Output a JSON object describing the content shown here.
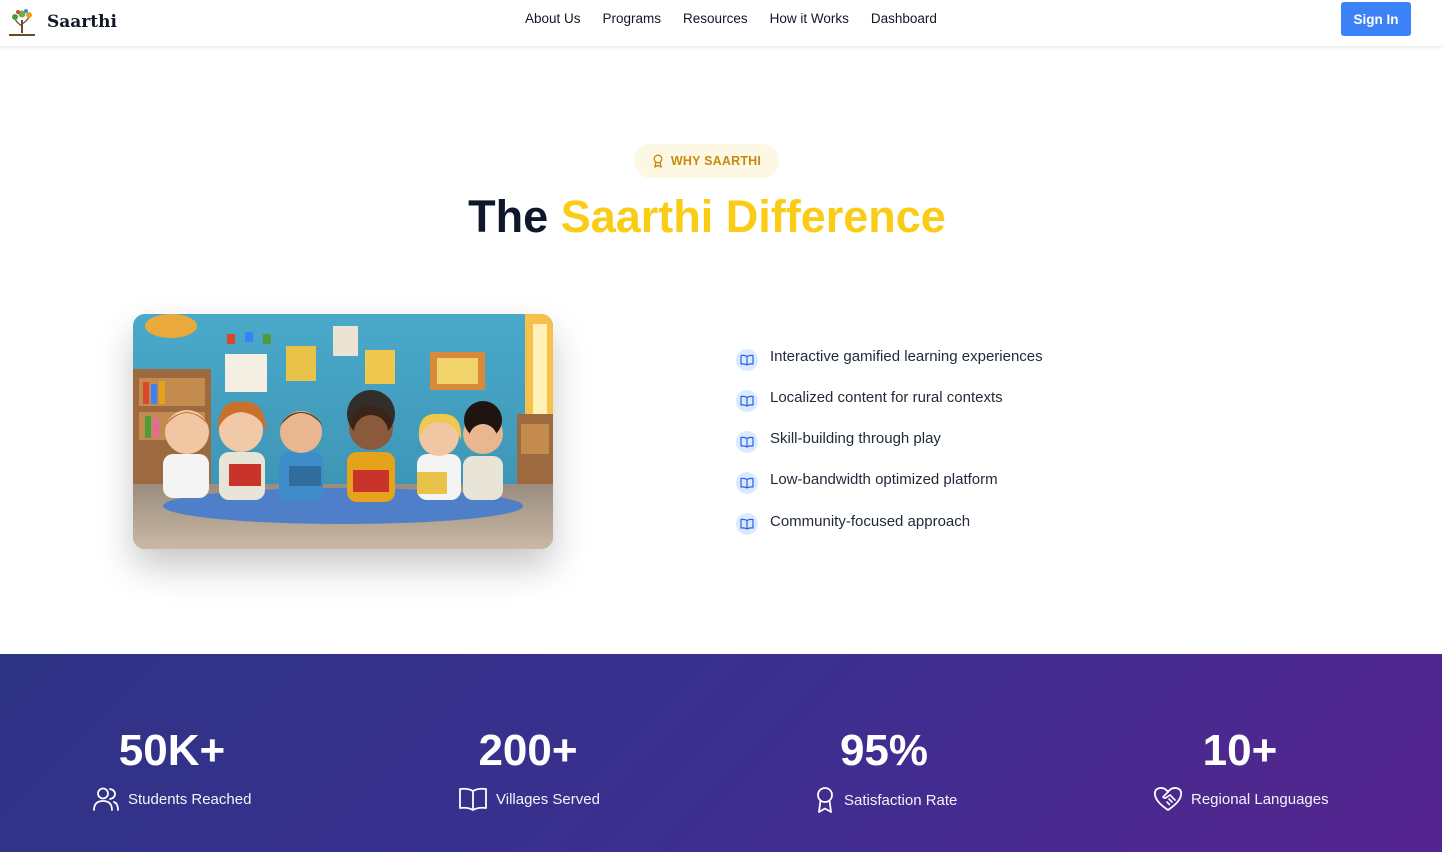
{
  "nav": {
    "brand": "Saarthi",
    "links": [
      "About Us",
      "Programs",
      "Resources",
      "How it Works",
      "Dashboard"
    ],
    "signin_label": "Sign In"
  },
  "hero": {
    "badge": "WHY SAARTHI",
    "title_plain": "The",
    "title_accent": "Saarthi Difference",
    "image_alt": "Cartoon children reading books in a classroom",
    "features": [
      "Interactive gamified learning experiences",
      "Localized content for rural contexts",
      "Skill-building through play",
      "Low-bandwidth optimized platform",
      "Community-focused approach"
    ]
  },
  "stats": [
    {
      "value": "50K+",
      "label": "Students Reached",
      "icon": "users-icon"
    },
    {
      "value": "200+",
      "label": "Villages Served",
      "icon": "book-icon"
    },
    {
      "value": "95%",
      "label": "Satisfaction Rate",
      "icon": "award-icon"
    },
    {
      "value": "10+",
      "label": "Regional Languages",
      "icon": "heart-handshake-icon"
    }
  ],
  "colors": {
    "accent_yellow": "#facc15",
    "badge_text": "#c98a0b",
    "primary_blue": "#3b82f6",
    "stats_gradient_start": "#2e3386",
    "stats_gradient_end": "#56248f"
  }
}
